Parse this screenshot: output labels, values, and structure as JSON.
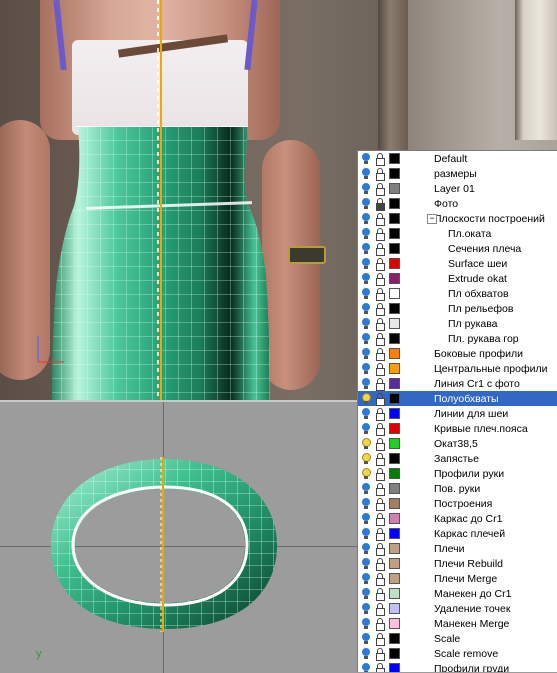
{
  "viewport_top": {
    "name": "front-view"
  },
  "viewport_bottom": {
    "name": "top-view",
    "axis_label": "y"
  },
  "layers": [
    {
      "name": "Default",
      "color": "#000000",
      "visible": true,
      "locked": false,
      "level": 0
    },
    {
      "name": "размеры",
      "color": "#000000",
      "visible": true,
      "locked": false,
      "level": 0
    },
    {
      "name": "Layer 01",
      "color": "#7f7f7f",
      "visible": true,
      "locked": false,
      "level": 0
    },
    {
      "name": "Фото",
      "color": "#000000",
      "visible": true,
      "locked": true,
      "level": 0
    },
    {
      "name": "Плоскости построений",
      "color": "#000000",
      "visible": true,
      "locked": false,
      "level": 0,
      "expanded": true
    },
    {
      "name": "Пл.оката",
      "color": "#000000",
      "visible": true,
      "locked": false,
      "level": 1
    },
    {
      "name": "Сечения плеча",
      "color": "#000000",
      "visible": true,
      "locked": false,
      "level": 1
    },
    {
      "name": "Surface шеи",
      "color": "#e00000",
      "visible": true,
      "locked": false,
      "level": 1
    },
    {
      "name": "Extrude okat",
      "color": "#8b1f6b",
      "visible": true,
      "locked": false,
      "level": 1
    },
    {
      "name": "Пл обхватов",
      "color": "#ffffff",
      "visible": true,
      "locked": false,
      "level": 1
    },
    {
      "name": "Пл рельефов",
      "color": "#000000",
      "visible": true,
      "locked": false,
      "level": 1
    },
    {
      "name": "Пл рукава",
      "color": "#e8e8e8",
      "visible": true,
      "locked": false,
      "level": 1
    },
    {
      "name": "Пл. рукава гор",
      "color": "#000000",
      "visible": true,
      "locked": false,
      "level": 1
    },
    {
      "name": "Боковые профили",
      "color": "#ff8000",
      "visible": true,
      "locked": false,
      "level": 0
    },
    {
      "name": "Центральные профили",
      "color": "#ffa000",
      "visible": true,
      "locked": false,
      "level": 0
    },
    {
      "name": "Линия Сr1 с фото",
      "color": "#5a2aa0",
      "visible": true,
      "locked": false,
      "level": 0
    },
    {
      "name": "Полуобхваты",
      "color": "#000000",
      "visible": true,
      "locked": false,
      "level": 0,
      "selected": true,
      "bulb_on": true
    },
    {
      "name": "Линии для шеи",
      "color": "#0000ff",
      "visible": true,
      "locked": false,
      "level": 0
    },
    {
      "name": "Кривые плеч.пояса",
      "color": "#e00000",
      "visible": true,
      "locked": false,
      "level": 0
    },
    {
      "name": "Окат38,5",
      "color": "#20d020",
      "visible": true,
      "locked": false,
      "level": 0,
      "bulb_on": true
    },
    {
      "name": "Запястье",
      "color": "#000000",
      "visible": true,
      "locked": false,
      "level": 0,
      "bulb_on": true
    },
    {
      "name": "Профили руки",
      "color": "#008000",
      "visible": true,
      "locked": false,
      "level": 0,
      "bulb_on": true
    },
    {
      "name": "Пов. руки",
      "color": "#808080",
      "visible": true,
      "locked": false,
      "level": 0
    },
    {
      "name": "Построения",
      "color": "#a08060",
      "visible": true,
      "locked": false,
      "level": 0
    },
    {
      "name": "Каркас до Сr1",
      "color": "#d080b0",
      "visible": true,
      "locked": false,
      "level": 0
    },
    {
      "name": "Каркас плечей",
      "color": "#0000ff",
      "visible": true,
      "locked": false,
      "level": 0
    },
    {
      "name": "Плечи",
      "color": "#c0a080",
      "visible": true,
      "locked": false,
      "level": 0
    },
    {
      "name": "Плечи  Rebuild",
      "color": "#c0a080",
      "visible": true,
      "locked": false,
      "level": 0
    },
    {
      "name": "Плечи Merge",
      "color": "#c0a080",
      "visible": true,
      "locked": false,
      "level": 0
    },
    {
      "name": "Манекен до Сr1",
      "color": "#c0e0c0",
      "visible": true,
      "locked": false,
      "level": 0
    },
    {
      "name": "Удаление точек",
      "color": "#c0c0ff",
      "visible": true,
      "locked": false,
      "level": 0
    },
    {
      "name": "Манекен Merge",
      "color": "#ffc0e0",
      "visible": true,
      "locked": false,
      "level": 0
    },
    {
      "name": "Scale",
      "color": "#000000",
      "visible": true,
      "locked": false,
      "level": 0
    },
    {
      "name": "Scale remove",
      "color": "#000000",
      "visible": true,
      "locked": false,
      "level": 0
    },
    {
      "name": "Профили груди",
      "color": "#0000ff",
      "visible": true,
      "locked": false,
      "level": 0
    }
  ]
}
